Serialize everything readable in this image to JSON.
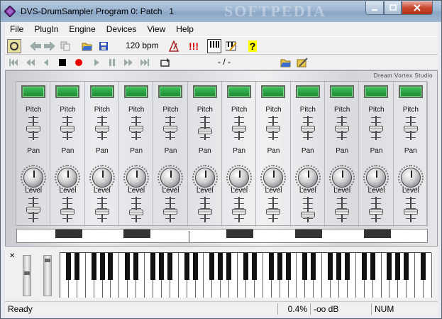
{
  "window": {
    "title": "DVS-DrumSampler Program 0: Patch   1",
    "watermark": "SOFTPEDIA"
  },
  "menu": [
    "File",
    "PlugIn",
    "Engine",
    "Devices",
    "View",
    "Help"
  ],
  "toolbar": {
    "bpm": "120 bpm",
    "alert": "!!!",
    "help": "?"
  },
  "transport": {
    "position": "- / -"
  },
  "mixer": {
    "brand": "Dream Vortex Studio",
    "channel_count": 12,
    "labels": {
      "pitch": "Pitch",
      "pan": "Pan",
      "level": "Level"
    },
    "pitch_levels": [
      0.55,
      0.55,
      0.55,
      0.55,
      0.55,
      0.4,
      0.55,
      0.55,
      0.55,
      0.55,
      0.55,
      0.55
    ],
    "level_levels": [
      0.55,
      0.45,
      0.45,
      0.4,
      0.45,
      0.45,
      0.45,
      0.45,
      0.3,
      0.45,
      0.45,
      0.45
    ],
    "pattern_blocks": [
      1,
      3,
      6,
      8,
      10
    ],
    "pattern_dividers": [
      5
    ]
  },
  "status": {
    "ready": "Ready",
    "cpu": "0.4%",
    "db": "-oo dB",
    "num": "NUM"
  },
  "colors": {
    "trigger": "#2aa43f",
    "title_bar": "#9db6d2",
    "close": "#c8472e"
  }
}
